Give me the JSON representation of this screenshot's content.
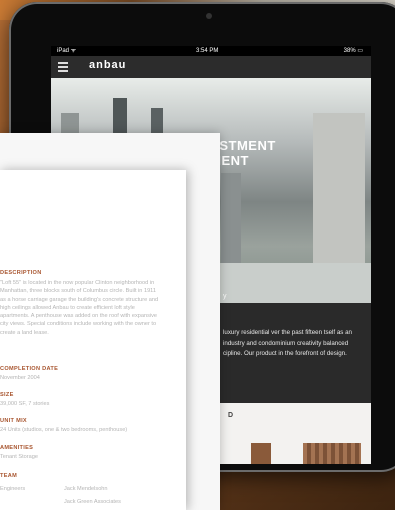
{
  "status_bar": {
    "left": "iPad ᯤ",
    "time": "3:54 PM",
    "battery": "38% ▭"
  },
  "navbar": {
    "logo": "anbau"
  },
  "hero": {
    "title_line1": "VESTMENT",
    "title_line2": "PMENT",
    "letter": "y"
  },
  "dark_section": {
    "paragraph": "luxury residential ver the past fifteen tself as an industry and condominium creativity balanced cipline. Our product in the forefront of design."
  },
  "light_section": {
    "heading": "D"
  },
  "document": {
    "description_label": "DESCRIPTION",
    "description_text": "\"Loft 55\" is located in the now popular Clinton neighborhood in Manhattan, three blocks south of Columbus circle. Built in 1911 as a horse carriage garage the building's concrete structure and high ceilings allowed Anbau to create efficient loft style apartments. A penthouse was added on the roof with expansive city views. Special conditions include working with the owner to create a land lease.",
    "completion_label": "COMPLETION DATE",
    "completion_value": "November 2004",
    "size_label": "SIZE",
    "size_value": "39,000 SF, 7 stories",
    "unit_mix_label": "UNIT MIX",
    "unit_mix_value": "24 Units (studios, one & two bedrooms, penthouse)",
    "amenities_label": "AMENITIES",
    "amenities_value": "Tenant Storage",
    "team_label": "TEAM",
    "team": [
      {
        "role": "Engineers",
        "name": "Jack Mendelsohn"
      },
      {
        "role": "",
        "name": "Jack Green Associates"
      }
    ]
  }
}
